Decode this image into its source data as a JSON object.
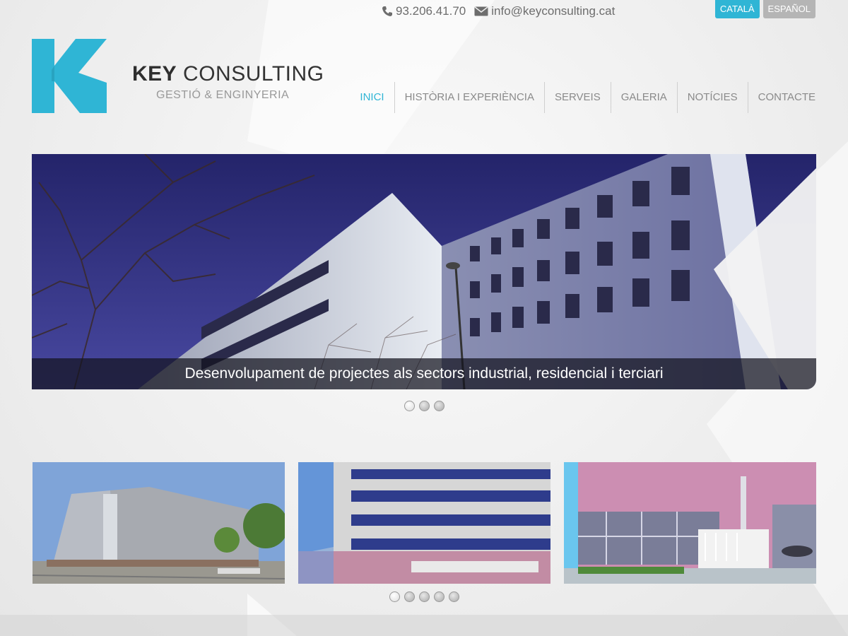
{
  "contact": {
    "phone": "93.206.41.70",
    "email": "info@keyconsulting.cat",
    "phone_icon": "phone-icon",
    "email_icon": "envelope-icon"
  },
  "languages": [
    {
      "label": "CATALÀ",
      "active": true
    },
    {
      "label": "ESPAÑOL",
      "active": false
    }
  ],
  "brand": {
    "name_bold": "KEY",
    "name_rest": "CONSULTING",
    "tagline": "GESTIÓ & ENGINYERIA",
    "logo_icon": "k-logo-icon",
    "accent_color": "#2fb5d5"
  },
  "nav": {
    "items": [
      {
        "label": "INICI",
        "active": true
      },
      {
        "label": "HISTÒRIA I EXPERIÈNCIA",
        "active": false
      },
      {
        "label": "SERVEIS",
        "active": false
      },
      {
        "label": "GALERIA",
        "active": false
      },
      {
        "label": "NOTÍCIES",
        "active": false
      },
      {
        "label": "CONTACTE",
        "active": false
      }
    ]
  },
  "hero": {
    "caption": "Desenvolupament de projectes als sectors industrial, residencial i terciari",
    "dot_count": 3,
    "active_dot": 0
  },
  "gallery": {
    "dot_count": 5,
    "active_dot": 0
  }
}
